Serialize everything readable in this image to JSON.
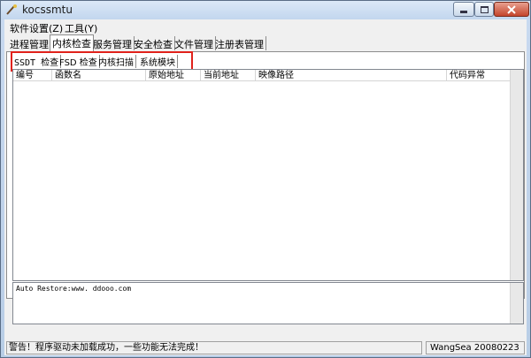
{
  "window": {
    "title": "kocssmtu"
  },
  "menu": {
    "items": [
      "软件设置(Z)",
      "工具(Y)"
    ]
  },
  "tabs": {
    "items": [
      "进程管理",
      "内核检查",
      "服务管理",
      "安全检查",
      "文件管理",
      "注册表管理"
    ],
    "active": "内核检查"
  },
  "subtabs": {
    "items": [
      "SSDT 检查",
      "FSD 检查",
      "内核扫描",
      "系统模块"
    ],
    "active": "SSDT 检查",
    "highlight_color": "#e0221b"
  },
  "list": {
    "columns": [
      "编号",
      "函数名",
      "原始地址",
      "当前地址",
      "映像路径",
      "代码异常"
    ],
    "rows": []
  },
  "log": {
    "text": "Auto Restore:www. ddooo.com"
  },
  "status": {
    "left": "警告！程序驱动未加载成功，一些功能无法完成！",
    "right": "WangSea 20080223"
  }
}
